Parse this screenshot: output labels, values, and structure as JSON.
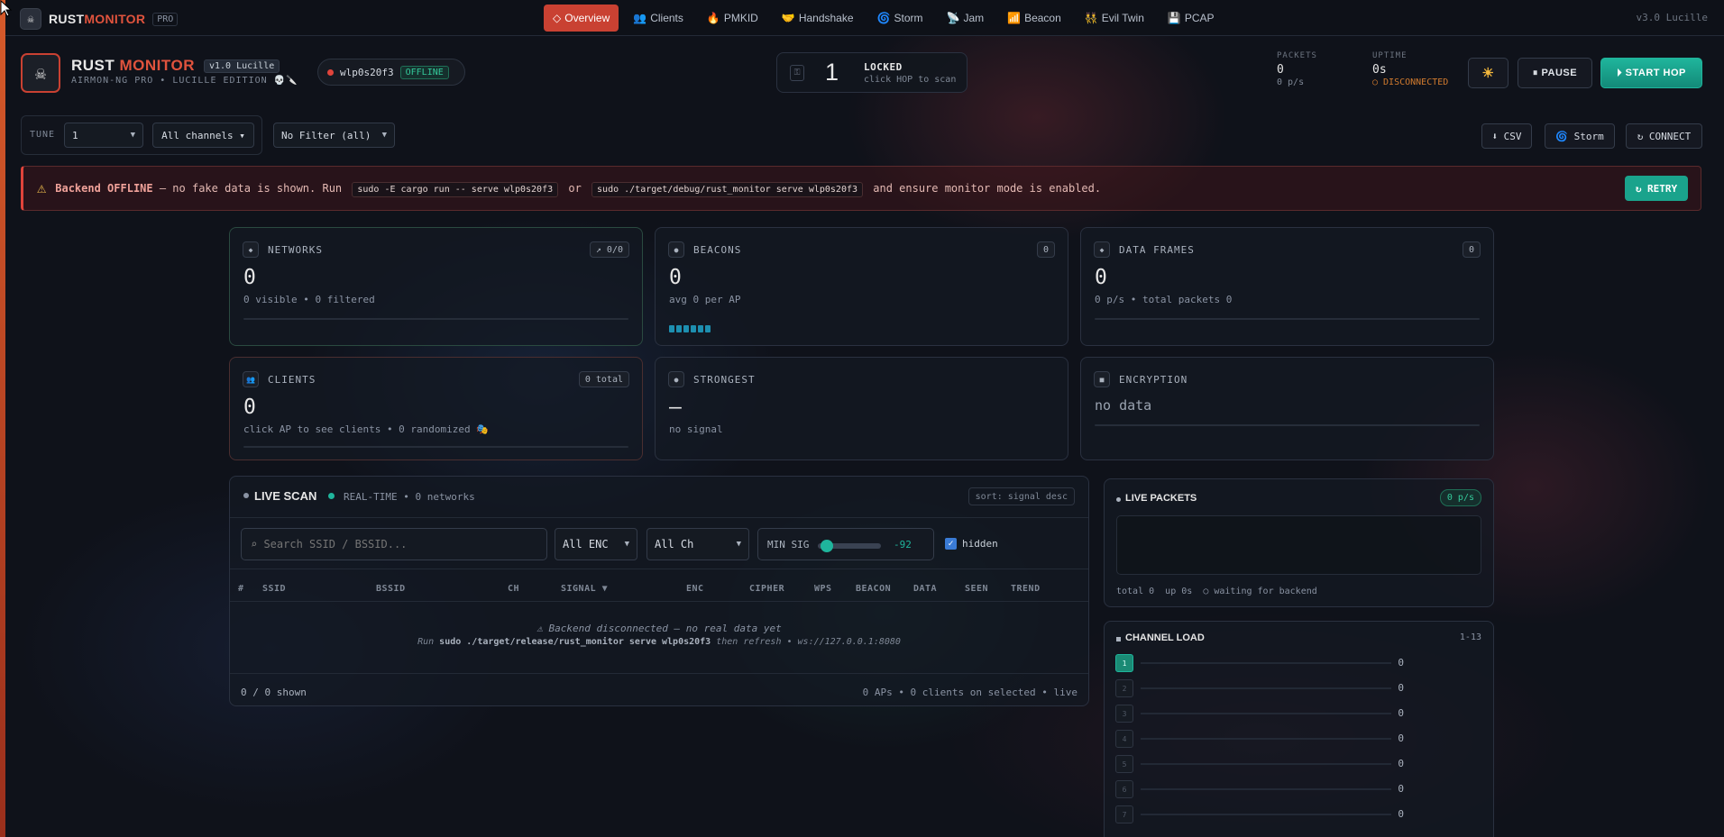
{
  "nav": {
    "brand_main": "RUST",
    "brand_accent": "MONITOR",
    "brand_tag": "PRO",
    "tabs": [
      {
        "icon": "◇",
        "label": "Overview"
      },
      {
        "icon": "👥",
        "label": "Clients"
      },
      {
        "icon": "🔥",
        "label": "PMKID"
      },
      {
        "icon": "🤝",
        "label": "Handshake"
      },
      {
        "icon": "🌀",
        "label": "Storm"
      },
      {
        "icon": "📡",
        "label": "Jam"
      },
      {
        "icon": "📶",
        "label": "Beacon"
      },
      {
        "icon": "👯",
        "label": "Evil Twin"
      },
      {
        "icon": "💾",
        "label": "PCAP"
      }
    ],
    "version": "v3.0 Lucille"
  },
  "header": {
    "title_main": "RUST",
    "title_accent": "MONITOR",
    "version_badge": "v1.0 Lucille",
    "subtitle": "AIRMON-NG PRO • LUCILLE EDITION 💀🔪",
    "interface": "wlp0s20f3",
    "interface_status": "OFFLINE",
    "channel_number": "1",
    "channel_state": "LOCKED",
    "channel_hint": "click HOP to scan",
    "packets_label": "PACKETS",
    "packets_value": "0",
    "packets_rate": "0 p/s",
    "uptime_label": "UPTIME",
    "uptime_value": "0s",
    "uptime_status": "○ DISCONNECTED",
    "theme_icon": "☀",
    "pause_label": "⏸ PAUSE",
    "start_hop_label": "⏵ START HOP"
  },
  "filters": {
    "tune_label": "TUNE",
    "tune_value": "1",
    "channels_value": "All channels ▾",
    "filter_value": "No Filter (all)",
    "csv_label": "⬇ CSV",
    "storm_label": "🌀 Storm",
    "connect_label": "↻ CONNECT"
  },
  "alert": {
    "bold": "Backend OFFLINE",
    "text1": " — no fake data is shown. Run ",
    "code1": "sudo -E cargo run -- serve wlp0s20f3",
    "text2": " or ",
    "code2": "sudo ./target/debug/rust_monitor serve wlp0s20f3",
    "text3": " and ensure monitor mode is enabled.",
    "retry_label": "↻ RETRY"
  },
  "cards": {
    "networks": {
      "title": "NETWORKS",
      "tag": "↗ 0/0",
      "value": "0",
      "desc": "0 visible • 0 filtered"
    },
    "beacons": {
      "title": "BEACONS",
      "tag": "0",
      "value": "0",
      "desc": "avg 0 per AP"
    },
    "data_frames": {
      "title": "DATA FRAMES",
      "tag": "0",
      "value": "0",
      "desc": "0 p/s • total packets 0"
    },
    "clients": {
      "title": "CLIENTS",
      "tag": "0 total",
      "value": "0",
      "desc": "click AP to see clients • 0 randomized 🎭"
    },
    "strongest": {
      "title": "STRONGEST",
      "value": "—",
      "desc": "no signal"
    },
    "encryption": {
      "title": "ENCRYPTION",
      "value": "no data"
    }
  },
  "scan": {
    "title": "LIVE SCAN",
    "realtime": "REAL-TIME • 0 networks",
    "sort": "sort: signal desc",
    "search_placeholder": "⌕ Search SSID / BSSID...",
    "enc_filter": "All ENC",
    "ch_filter": "All Ch",
    "min_sig_label": "MIN SIG",
    "min_sig_value": "-92",
    "min_sig_level": 0.05,
    "hidden_label": "hidden",
    "columns": [
      "#",
      "SSID",
      "BSSID",
      "CH",
      "SIGNAL ▼",
      "ENC",
      "CIPHER",
      "WPS",
      "BEACON",
      "DATA",
      "SEEN",
      "TREND"
    ],
    "empty_line1": "⚠ Backend disconnected — no real data yet",
    "empty_line2_pre": "Run ",
    "empty_line2_cmd": "sudo ./target/release/rust_monitor serve wlp0s20f3",
    "empty_line2_post": " then refresh • ws://127.0.0.1:8080",
    "shown": "0 / 0 shown",
    "footer_right": "0 APs • 0 clients on selected • live"
  },
  "live_packets": {
    "title": "LIVE PACKETS",
    "rate": "0 p/s",
    "footer": "total 0  up 0s  ○ waiting for backend"
  },
  "channel_load": {
    "title": "CHANNEL LOAD",
    "range": "1-13",
    "channels": [
      {
        "ch": "1",
        "value": "0",
        "active": true
      },
      {
        "ch": "2",
        "value": "0",
        "active": false
      },
      {
        "ch": "3",
        "value": "0",
        "active": false
      },
      {
        "ch": "4",
        "value": "0",
        "active": false
      },
      {
        "ch": "5",
        "value": "0",
        "active": false
      },
      {
        "ch": "6",
        "value": "0",
        "active": false
      },
      {
        "ch": "7",
        "value": "0",
        "active": false
      }
    ]
  },
  "colors": {
    "accent": "#c94132",
    "teal": "#1fb59c",
    "background": "#0f121a"
  }
}
